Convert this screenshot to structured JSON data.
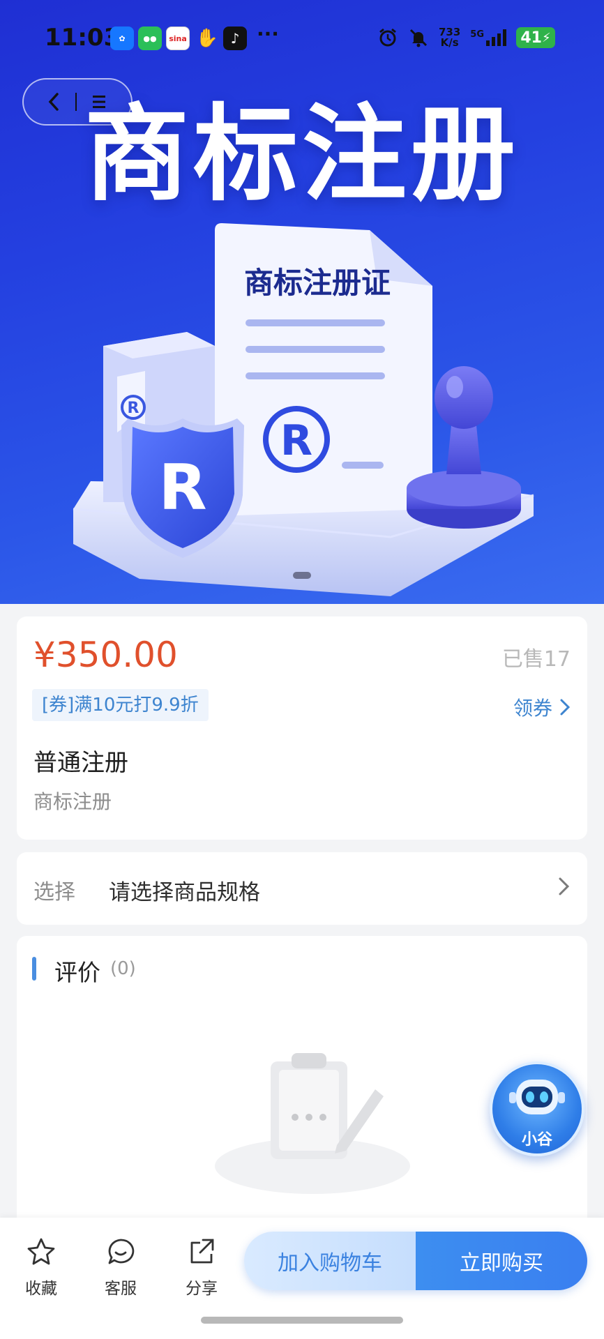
{
  "status_bar": {
    "time": "11:03",
    "net_speed_value": "733",
    "net_speed_unit": "K/s",
    "signal_label": "5G",
    "battery": "41",
    "more": "···",
    "apps": [
      "alipay-icon",
      "wechat-icon",
      "sina-icon",
      "hand-icon",
      "tiktok-icon"
    ]
  },
  "hero": {
    "title": "商标注册",
    "certificate_title": "商标注册证",
    "registered_mark": "R"
  },
  "product": {
    "price": "¥350.00",
    "sold": "已售17",
    "coupon": "[券]满10元打9.9折",
    "get_coupon": "领券",
    "name": "普通注册",
    "subtitle": "商标注册"
  },
  "spec": {
    "label": "选择",
    "value": "请选择商品规格"
  },
  "reviews": {
    "title": "评价",
    "count": "(0)"
  },
  "assistant": {
    "label": "小谷"
  },
  "bottom_bar": {
    "favorite": "收藏",
    "service": "客服",
    "share": "分享",
    "add_to_cart": "加入购物车",
    "buy_now": "立即购买"
  },
  "colors": {
    "price": "#e0502c",
    "accent": "#3d84cf",
    "buy": "#3a7ff0",
    "hero_top": "#1f2fd3"
  }
}
